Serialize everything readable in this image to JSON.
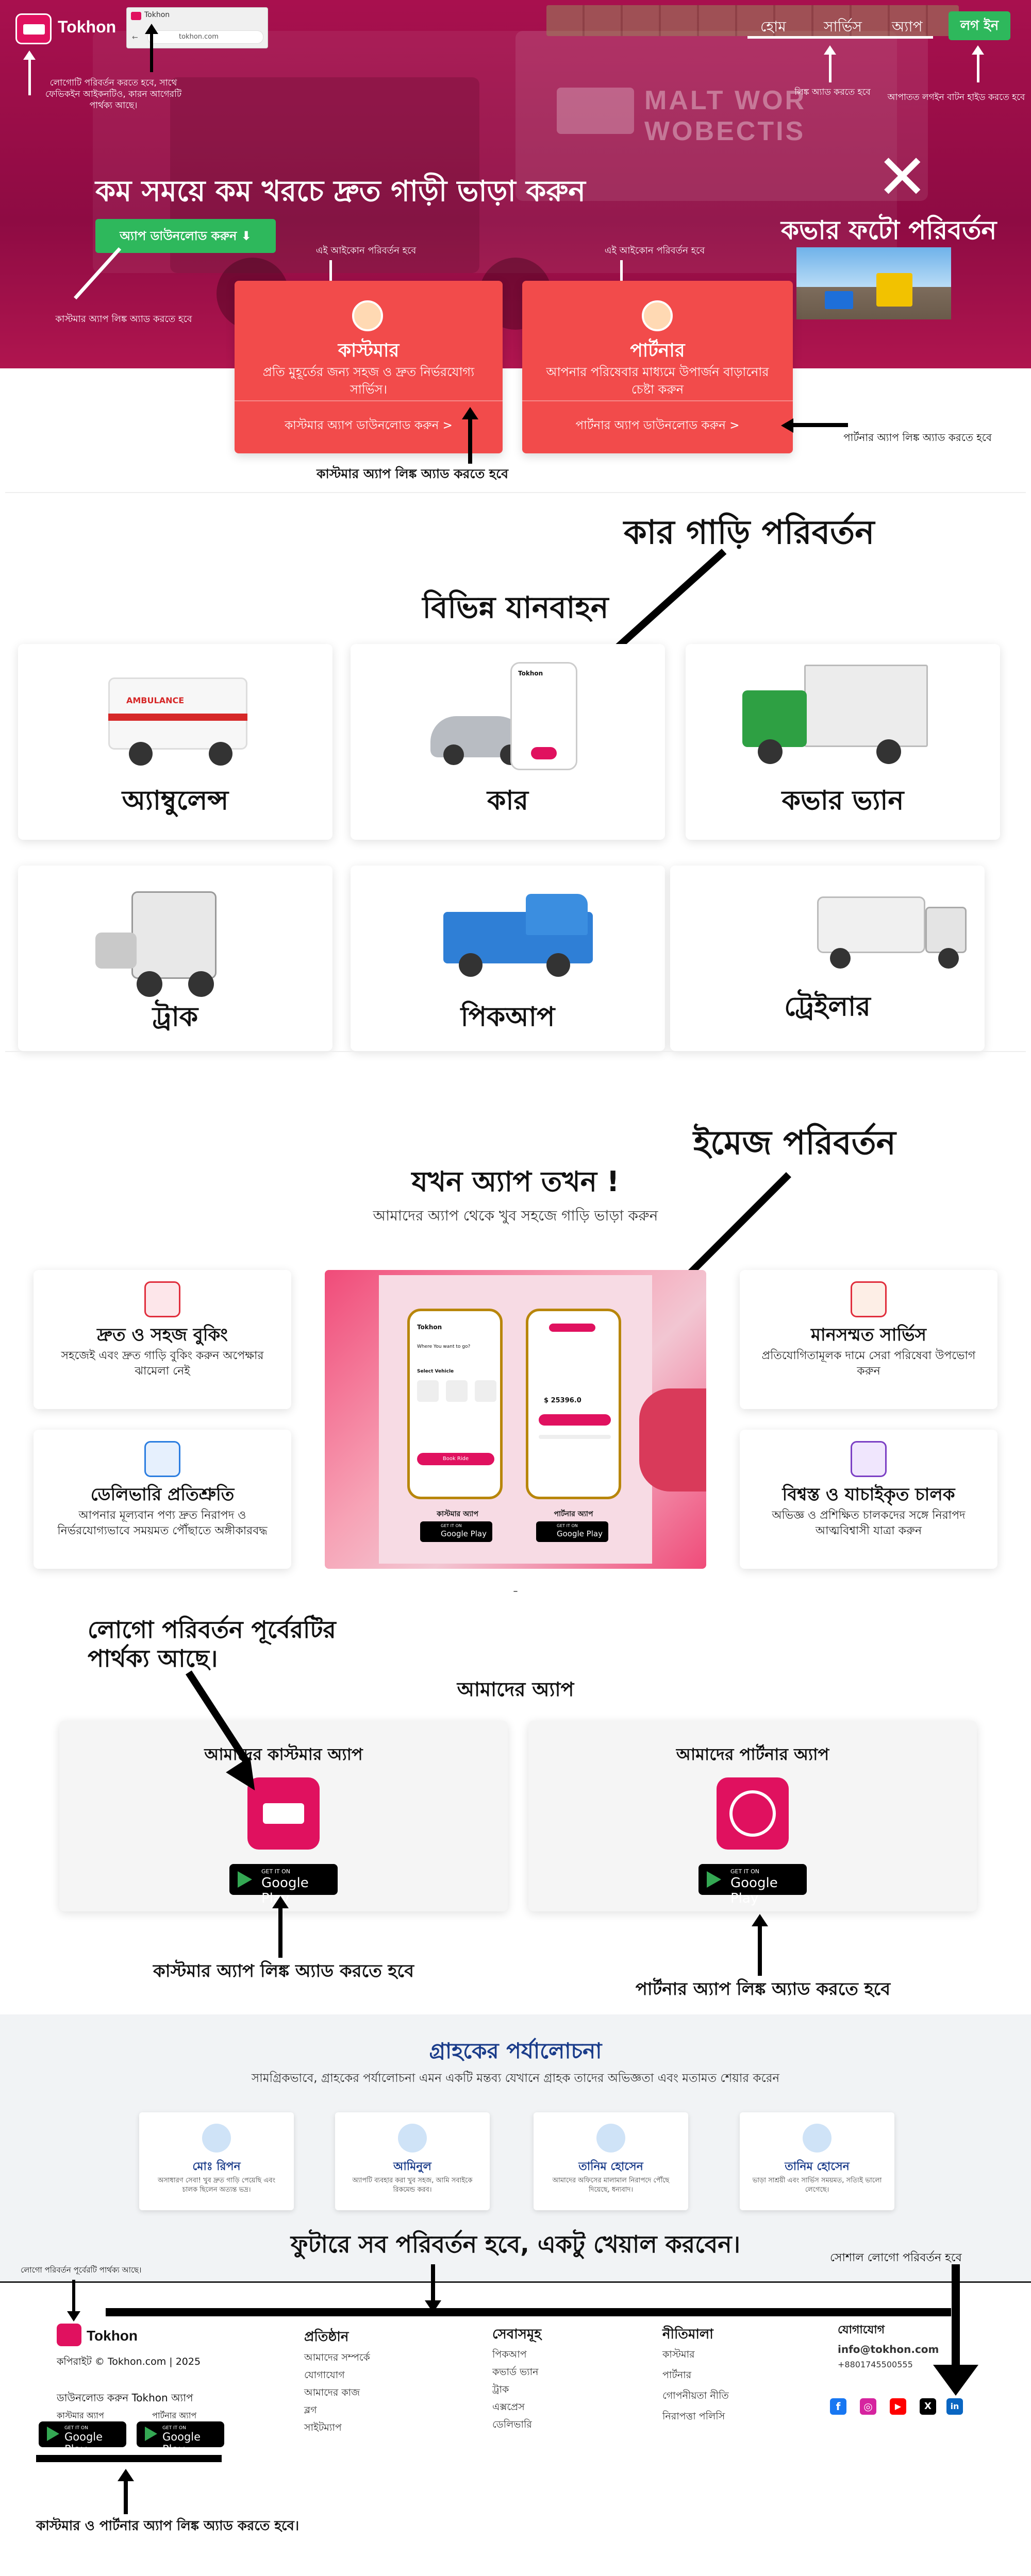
{
  "brand": {
    "name": "Tokhon",
    "color": "#e0115f"
  },
  "browser_tab": {
    "title": "Tokhon",
    "url": "tokhon.com"
  },
  "nav": {
    "items": [
      "হোম",
      "সার্ভিস",
      "অ্যাপ"
    ],
    "login": "লগ ইন"
  },
  "hero": {
    "headline": "কম সময়ে কম খরচে দ্রুত গাড়ী ভাড়া করুন",
    "download_button": "অ্যাপ ডাউনলোড করুন",
    "truck_text_1": "MALT WOR",
    "truck_text_2": "WOBECTIS",
    "close_symbol": "✕",
    "cover_change": "কভার ফটো পরিবর্তন"
  },
  "annotations": {
    "logo_note": "লোগোটি পরিবর্তন করতে হবে, সাথে ফেভিকইন আইকনটিও, কারন আগেরটি পার্থক্য আছে।",
    "nav_link_note": "লিঙ্ক অ্যাড করতে হবে",
    "login_note": "আপাতত লগইন বাটন হাইড করতে হবে",
    "customer_icon_change": "এই আইকোন পরিবর্তন হবে",
    "partner_icon_change": "এই আইকোন পরিবর্তন হবে",
    "customer_app_link_hero": "কাস্টমার অ্যাপ লিঙ্ক অ্যাড করতে হবে",
    "partner_app_link_hero": "পার্টনার অ্যাপ লিঙ্ক অ্যাড করতে হবে",
    "customer_app_link_cards": "কাস্টমার অ্যাপ লিঙ্ক অ্যাড করতে হবে",
    "car_change": "কার গাড়ি পরিবর্তন",
    "image_change": "ইমেজ পরিবর্তন",
    "logo_change": "লোগো পরিবর্তন পূর্বেরটির পার্থক্য আছে।",
    "customer_app_link_apps": "কাস্টমার অ্যাপ লিঙ্ক অ্যাড করতে হবে",
    "partner_app_link_apps": "পার্টনার অ্যাপ লিঙ্ক অ্যাড করতে হবে",
    "future_note": "ফুটারে সব পরিবর্তন হবে, একটু খেয়াল করবেন।",
    "footer_logo_note": "লোগো পরিবর্তন পূর্বেরটি পার্থক্য আছে।",
    "social_logo_note": "সোশাল লোগো পরিবর্তন হবে",
    "footer_apps_note": "কাস্টমার ও পার্টনার অ্যাপ লিঙ্ক অ্যাড করতে হবে।"
  },
  "customer_card": {
    "title": "কাস্টমার",
    "desc": "প্রতি মুহূর্তের জন্য সহজ ও দ্রুত নির্ভরযোগ্য সার্ভিস।",
    "link": "কাস্টমার অ্যাপ ডাউনলোড করুন >"
  },
  "partner_card": {
    "title": "পার্টনার",
    "desc": "আপনার পরিষেবার মাধ্যমে উপার্জন বাড়ানোর চেষ্টা করুন",
    "link": "পার্টনার অ্যাপ ডাউনলোড করুন >"
  },
  "vehicles": {
    "title": "বিভিন্ন যানবাহন",
    "items": [
      "অ্যাম্বুলেন্স",
      "কার",
      "কভার ভ্যান",
      "ট্রাক",
      "পিকআপ",
      "ট্রেইলার"
    ],
    "ambulance_text": "AMBULANCE"
  },
  "features": {
    "title": "যখন অ্যাপ তখন !",
    "subtitle": "আমাদের অ্যাপ থেকে খুব সহজে গাড়ি ভাড়া করুন",
    "items": [
      {
        "title": "দ্রুত ও সহজ বুকিং",
        "desc": "সহজেই এবং দ্রুত গাড়ি বুকিং করুন অপেক্ষার ঝামেলা নেই"
      },
      {
        "title": "ডেলিভারি প্রতিশ্রুতি",
        "desc": "আপনার মূল্যবান পণ্য দ্রুত নিরাপদ ও নির্ভরযোগ্যভাবে সময়মত পৌঁছাতে অঙ্গীকারবদ্ধ"
      },
      {
        "title": "মানসম্মত সার্ভিস",
        "desc": "প্রতিযোগিতামূলক দামে সেরা পরিষেবা উপভোগ করুন"
      },
      {
        "title": "বিশ্বস্ত ও যাচাইকৃত চালক",
        "desc": "অভিজ্ঞ ও প্রশিক্ষিত চালকদের সঙ্গে নিরাপদ আত্মবিশ্বাসী যাত্রা করুন"
      }
    ],
    "phone_customer_label": "কাস্টমার অ্যাপ",
    "phone_partner_label": "পার্টনার অ্যাপ",
    "phone_header": "Tokhon",
    "phone_question": "Where You want to go?",
    "phone_select": "Select Vehicle",
    "phone_button": "Book Ride",
    "phone_price": "$ 25396.0",
    "badge_get": "GET IT ON",
    "badge_store": "Google Play",
    "section_dot": "–"
  },
  "apps": {
    "title": "আমাদের অ্যাপ",
    "customer_title": "আমাদের কাস্টমার অ্যাপ",
    "partner_title": "আমাদের পার্টনার অ্যাপ",
    "badge_get": "GET IT ON",
    "badge_store": "Google Play"
  },
  "reviews": {
    "title": "গ্রাহকের পর্যালোচনা",
    "subtitle": "সামগ্রিকভাবে, গ্রাহকের পর্যালোচনা এমন একটি মন্তব্য যেখানে গ্রাহক তাদের অভিজ্ঞতা এবং মতামত শেয়ার করেন",
    "items": [
      {
        "name": "মোঃ রিপন",
        "text": "অসাধারণ সেবা! খুব দ্রুত গাড়ি পেয়েছি এবং চালক ছিলেন অত্যন্ত ভদ্র।"
      },
      {
        "name": "আমিনুল",
        "text": "অ্যাপটি ব্যবহার করা খুব সহজ, আমি সবাইকে রিকমেন্ড করব।"
      },
      {
        "name": "তানিম হোসেন",
        "text": "আমাদের অফিসের মালামাল নিরাপদে পৌঁছে দিয়েছে, ধন্যবাদ।"
      },
      {
        "name": "তানিম হোসেন",
        "text": "ভাড়া সাশ্রয়ী এবং সার্ভিস সময়মত, সত্যিই ভালো লেগেছে।"
      }
    ]
  },
  "footer": {
    "brand": "Tokhon",
    "copyright": "কপিরাইট © Tokhon.com | 2025",
    "download_title": "ডাউনলোড করুন Tokhon অ্যাপ",
    "customer_app": "কাস্টমার অ্যাপ",
    "partner_app": "পার্টনার অ্যাপ",
    "badge_get": "GET IT ON",
    "badge_store": "Google Play",
    "columns": [
      {
        "title": "প্রতিষ্ঠান",
        "links": [
          "আমাদের সম্পর্কে",
          "যোগাযোগ",
          "আমাদের কাজ",
          "ব্লগ",
          "সাইটম্যাপ"
        ]
      },
      {
        "title": "সেবাসমূহ",
        "links": [
          "পিকআপ",
          "কভার্ড ভ্যান",
          "ট্রাক",
          "এক্সপ্রেস",
          "ডেলিভারি"
        ]
      },
      {
        "title": "নীতিমালা",
        "links": [
          "কাস্টমার",
          "পার্টনার",
          "গোপনীয়তা নীতি",
          "নিরাপত্তা পলিসি"
        ]
      }
    ],
    "contact_title": "যোগাযোগ",
    "email": "info@tokhon.com",
    "phone": "+8801745500555",
    "socials": [
      "f",
      "◎",
      "▶",
      "X",
      "in"
    ]
  }
}
